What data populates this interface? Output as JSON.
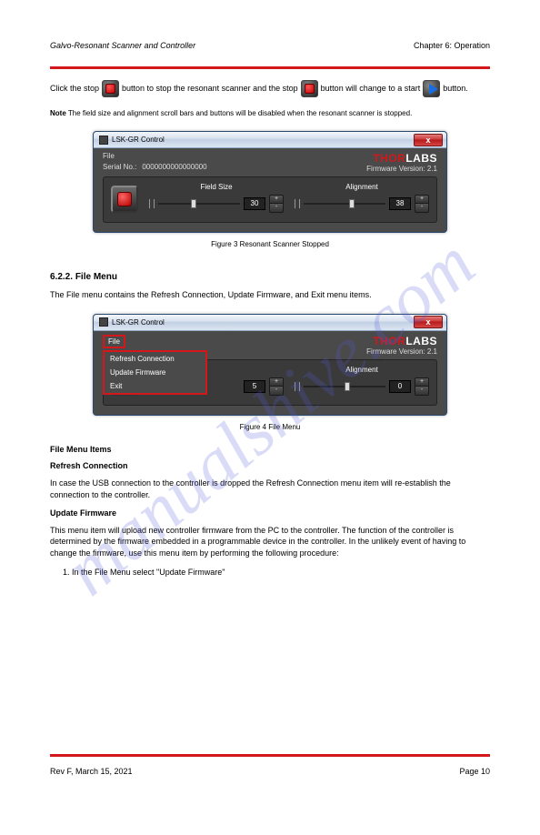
{
  "header": {
    "left_italic": "Galvo-Resonant Scanner and Controller",
    "right": "Chapter 6: Operation"
  },
  "intro": {
    "line1_a": "Click the stop",
    "line1_b": "button to stop the resonant scanner and the stop",
    "line1_c": "button will",
    "line2_a": "change to a start",
    "line2_b": "button.",
    "note_label": "Note",
    "note_text": "The field size and alignment scroll bars and buttons will be disabled when the resonant scanner is stopped."
  },
  "figure3_caption": "Figure 3 Resonant Scanner Stopped",
  "section_num": "6.2.2.",
  "section_title": "File Menu",
  "menu_text": "The File menu contains the Refresh Connection, Update Firmware, and Exit menu items.",
  "window": {
    "title": "LSK-GR Control",
    "file_label": "File",
    "serial_label": "Serial No.:",
    "serial_value": "0000000000000000",
    "brand_thor": "THOR",
    "brand_labs": "LABS",
    "fw_label": "Firmware Version:",
    "fw_value": "2.1",
    "field_size_label": "Field Size",
    "alignment_label": "Alignment",
    "field_size_value_a": "30",
    "alignment_value_a": "38",
    "field_size_value_b": "5",
    "alignment_value_b": "0",
    "plus": "+",
    "minus": "-",
    "close_x": "x"
  },
  "dropdown": {
    "refresh": "Refresh Connection",
    "update": "Update Firmware",
    "exit": "Exit"
  },
  "figure4_caption": "Figure 4 File Menu",
  "file_menu_items_heading": "File Menu Items",
  "refresh_label": "Refresh Connection",
  "refresh_text": "In case the USB connection to the controller is dropped the Refresh Connection menu item will re-establish the connection to the controller.",
  "update_label": "Update Firmware",
  "update_text1": "This menu item will upload new controller firmware from the PC to the controller. The function of the controller is determined by the firmware embedded in a programmable device in the controller. In the unlikely event of having to change the firmware, use this menu item by performing the following procedure:",
  "step1": "1. In the File Menu select \"Update Firmware\"",
  "footer": {
    "rev": "Rev F, March 15, 2021",
    "page": "Page 10"
  },
  "watermark": "manualshive.com"
}
